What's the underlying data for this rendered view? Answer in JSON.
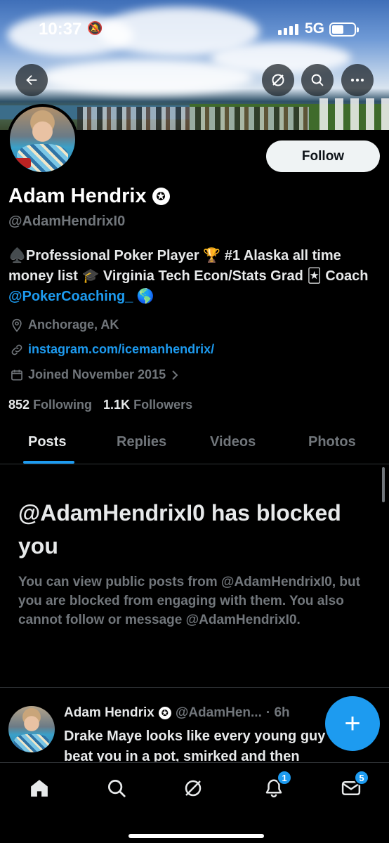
{
  "status_bar": {
    "time": "10:37",
    "network": "5G",
    "silent_icon": "bell-slash-icon"
  },
  "header": {
    "back_icon": "arrow-left-icon",
    "grok_icon": "grok-slash-icon",
    "search_icon": "search-icon",
    "more_icon": "more-horizontal-icon"
  },
  "profile": {
    "name": "Adam Hendrix",
    "handle": "@AdamHendrixI0",
    "follow_label": "Follow",
    "bio_part1": "♠️Professional Poker Player 🏆 #1 Alaska all time money list 🎓 Virginia Tech Econ/Stats Grad 🃏 Coach ",
    "bio_mention": "@PokerCoaching_",
    "bio_part2": " 🌎",
    "location": "Anchorage, AK",
    "website": "instagram.com/icemanhendrix/",
    "joined": "Joined November 2015",
    "following_count": "852",
    "following_label": "Following",
    "followers_count": "1.1K",
    "followers_label": "Followers"
  },
  "tabs": [
    {
      "label": "Posts",
      "active": true
    },
    {
      "label": "Replies",
      "active": false
    },
    {
      "label": "Videos",
      "active": false
    },
    {
      "label": "Photos",
      "active": false
    }
  ],
  "blocked": {
    "title": "@AdamHendrixI0 has blocked you",
    "description": "You can view public posts from @AdamHendrixI0, but you are blocked from engaging with them. You also cannot follow or message @AdamHendrixI0."
  },
  "post": {
    "name": "Adam Hendrix",
    "handle": "@AdamHen...",
    "time": "· 6h",
    "text": "Drake Maye looks like every young guy that beat you in a pot, smirked and then"
  },
  "fab": {
    "label": "+"
  },
  "bottom_nav": {
    "notifications_badge": "1",
    "messages_badge": "5"
  },
  "colors": {
    "accent": "#1d9bf0",
    "background": "#000000",
    "muted": "#71767b"
  }
}
